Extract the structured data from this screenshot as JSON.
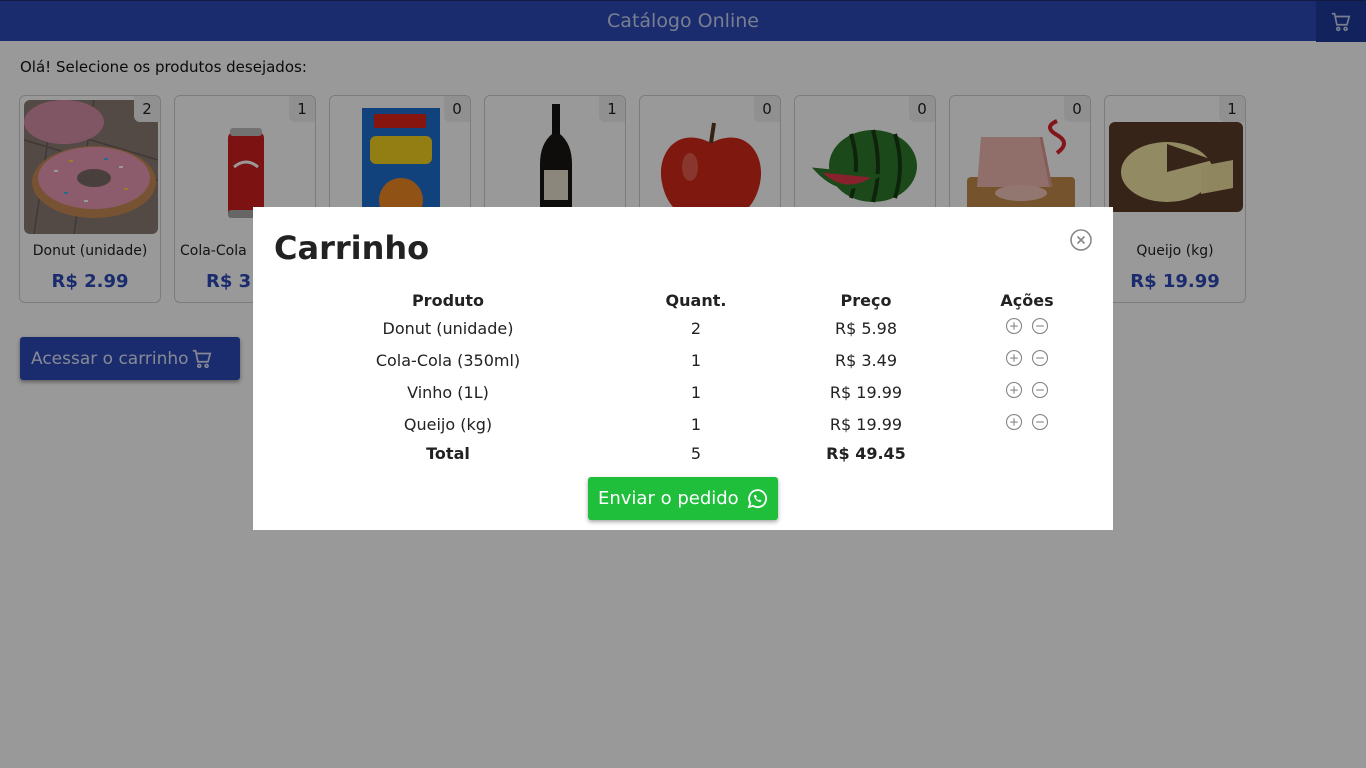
{
  "header": {
    "title": "Catálogo Online",
    "cart_icon": "cart-icon"
  },
  "greeting": "Olá! Selecione os produtos desejados:",
  "products": [
    {
      "name": "Donut (unidade)",
      "price": "R$ 2.99",
      "count": "2",
      "image": "donut-image"
    },
    {
      "name": "Cola-Cola",
      "price": "R$ 3",
      "count": "1",
      "image": "cola-can-image"
    },
    {
      "name": "",
      "price": "",
      "count": "0",
      "image": "cereal-box-image"
    },
    {
      "name": "",
      "price": "",
      "count": "1",
      "image": "wine-bottle-image"
    },
    {
      "name": "",
      "price": "",
      "count": "0",
      "image": "apple-image"
    },
    {
      "name": "",
      "price": "",
      "count": "0",
      "image": "watermelon-image"
    },
    {
      "name": "",
      "price": "",
      "count": "0",
      "image": "ham-image"
    },
    {
      "name": "Queijo (kg)",
      "price": "R$ 19.99",
      "count": "1",
      "image": "cheese-image"
    }
  ],
  "access_button": {
    "label": "Acessar o carrinho"
  },
  "cart_modal": {
    "title": "Carrinho",
    "headers": {
      "product": "Produto",
      "quantity": "Quant.",
      "price": "Preço",
      "actions": "Ações"
    },
    "rows": [
      {
        "product": "Donut (unidade)",
        "quantity": "2",
        "price": "R$ 5.98"
      },
      {
        "product": "Cola-Cola (350ml)",
        "quantity": "1",
        "price": "R$ 3.49"
      },
      {
        "product": "Vinho (1L)",
        "quantity": "1",
        "price": "R$ 19.99"
      },
      {
        "product": "Queijo (kg)",
        "quantity": "1",
        "price": "R$ 19.99"
      }
    ],
    "total": {
      "label": "Total",
      "quantity": "5",
      "price": "R$ 49.45"
    },
    "send_button": {
      "label": "Enviar o pedido"
    }
  },
  "colors": {
    "primary": "#2c4ab8",
    "whatsapp": "#1fbf3c"
  }
}
